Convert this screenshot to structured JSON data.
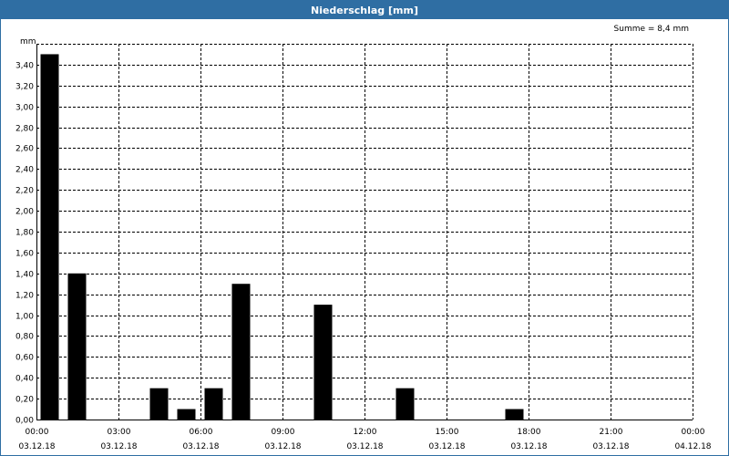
{
  "window": {
    "title": "Niederschlag [mm]"
  },
  "summary": "Summe = 8,4 mm",
  "colors": {
    "titlebar": "#2f6ea3",
    "bar": "#000000",
    "grid": "#000000"
  },
  "chart_data": {
    "type": "bar",
    "title": "Niederschlag [mm]",
    "ylabel": "mm",
    "xlabel": "",
    "ylim": [
      0,
      3.6
    ],
    "grid": true,
    "y_ticks": [
      "0,00",
      "0,20",
      "0,40",
      "0,60",
      "0,80",
      "1,00",
      "1,20",
      "1,40",
      "1,60",
      "1,80",
      "2,00",
      "2,20",
      "2,40",
      "2,60",
      "2,80",
      "3,00",
      "3,20",
      "3,40"
    ],
    "x_ticks": [
      {
        "time": "00:00",
        "date": "03.12.18"
      },
      {
        "time": "03:00",
        "date": "03.12.18"
      },
      {
        "time": "06:00",
        "date": "03.12.18"
      },
      {
        "time": "09:00",
        "date": "03.12.18"
      },
      {
        "time": "12:00",
        "date": "03.12.18"
      },
      {
        "time": "15:00",
        "date": "03.12.18"
      },
      {
        "time": "18:00",
        "date": "03.12.18"
      },
      {
        "time": "21:00",
        "date": "03.12.18"
      },
      {
        "time": "00:00",
        "date": "04.12.18"
      }
    ],
    "x_hours": [
      0,
      1,
      2,
      3,
      4,
      5,
      6,
      7,
      8,
      9,
      10,
      11,
      12,
      13,
      14,
      15,
      16,
      17,
      18,
      19,
      20,
      21,
      22,
      23
    ],
    "values": [
      3.5,
      1.4,
      0,
      0,
      0.3,
      0.1,
      0.3,
      1.3,
      0,
      0,
      1.1,
      0,
      0,
      0.3,
      0,
      0,
      0,
      0.1,
      0,
      0,
      0,
      0,
      0,
      0
    ]
  }
}
